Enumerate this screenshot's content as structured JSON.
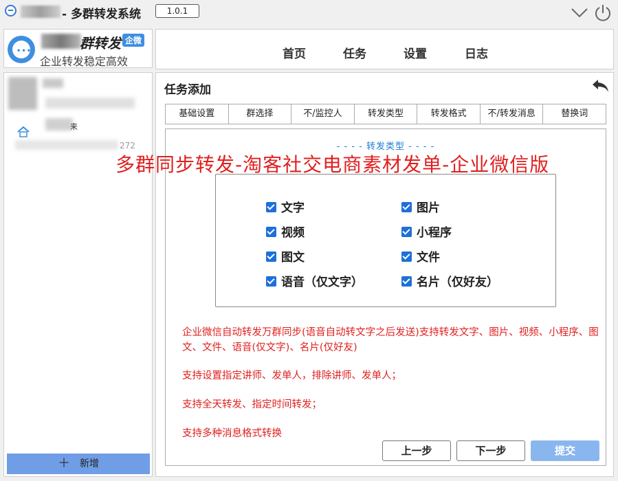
{
  "titlebar": {
    "app_title": "- 多群转发系统",
    "version": "1.0.1"
  },
  "brand": {
    "name": "群转发",
    "badge": "企微",
    "slogan": "企业转发稳定高效"
  },
  "contacts": {
    "number_fragment": "272",
    "fragment_char": "来",
    "add_button_label": "新增"
  },
  "nav": {
    "items": [
      "首页",
      "任务",
      "设置",
      "日志"
    ]
  },
  "task": {
    "title": "任务添加",
    "steps": [
      "基础设置",
      "群选择",
      "不/监控人",
      "转发类型",
      "转发格式",
      "不/转发消息",
      "替换词"
    ],
    "section_label": "- - - - 转发类型 - - - -",
    "overlay_title": "多群同步转发-淘客社交电商素材发单-企业微信版",
    "options": [
      {
        "label": "文字",
        "checked": true
      },
      {
        "label": "图片",
        "checked": true
      },
      {
        "label": "视频",
        "checked": true
      },
      {
        "label": "小程序",
        "checked": true
      },
      {
        "label": "图文",
        "checked": true
      },
      {
        "label": "文件",
        "checked": true
      },
      {
        "label": "语音（仅文字）",
        "checked": true
      },
      {
        "label": "名片（仅好友）",
        "checked": true
      }
    ],
    "descriptions": [
      "企业微信自动转发万群同步(语音自动转文字之后发送)支持转发文字、图片、视频、小程序、图文、文件、语音(仅文字)、名片(仅好友)",
      "支持设置指定讲师、发单人，排除讲师、发单人；",
      "支持全天转发、指定时间转发；",
      "支持多种消息格式转换"
    ],
    "buttons": {
      "prev": "上一步",
      "next": "下一步",
      "submit": "提交"
    }
  },
  "colors": {
    "accent": "#1e6fd9",
    "highlight_text": "#e02020",
    "section_label": "#1e7bd8",
    "add_button": "#6f9ee6",
    "submit_button": "#8ab6ef"
  }
}
